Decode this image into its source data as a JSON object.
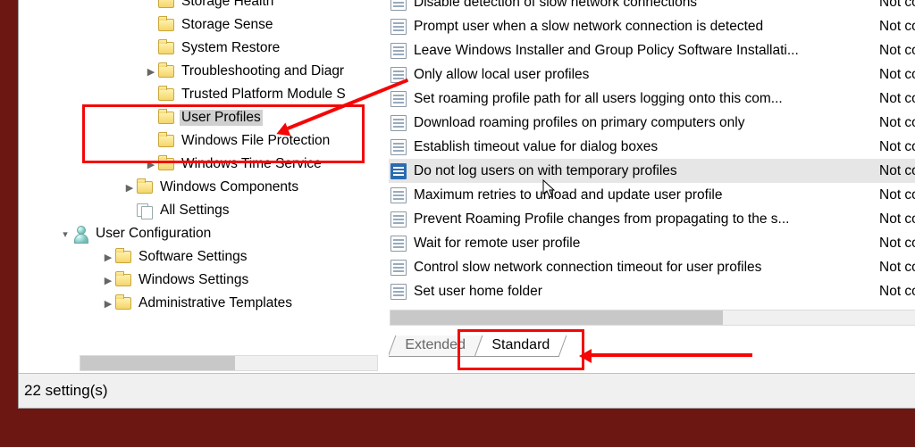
{
  "tree": [
    {
      "indent": 5,
      "exp": "",
      "icon": "folder",
      "label": "Storage Health"
    },
    {
      "indent": 5,
      "exp": "",
      "icon": "folder",
      "label": "Storage Sense"
    },
    {
      "indent": 5,
      "exp": "",
      "icon": "folder",
      "label": "System Restore"
    },
    {
      "indent": 5,
      "exp": ">",
      "icon": "folder",
      "label": "Troubleshooting and Diagr"
    },
    {
      "indent": 5,
      "exp": "",
      "icon": "folder",
      "label": "Trusted Platform Module S"
    },
    {
      "indent": 5,
      "exp": "",
      "icon": "folder",
      "label": "User Profiles",
      "selected": true
    },
    {
      "indent": 5,
      "exp": "",
      "icon": "folder",
      "label": "Windows File Protection"
    },
    {
      "indent": 5,
      "exp": ">",
      "icon": "folder",
      "label": "Windows Time Service"
    },
    {
      "indent": 4,
      "exp": ">",
      "icon": "folder",
      "label": "Windows Components"
    },
    {
      "indent": 4,
      "exp": "",
      "icon": "allset",
      "label": "All Settings"
    },
    {
      "indent": 1,
      "exp": "v",
      "icon": "userconf",
      "label": "User Configuration"
    },
    {
      "indent": 3,
      "exp": ">",
      "icon": "folder",
      "label": "Software Settings"
    },
    {
      "indent": 3,
      "exp": ">",
      "icon": "folder",
      "label": "Windows Settings"
    },
    {
      "indent": 3,
      "exp": ">",
      "icon": "folder",
      "label": "Administrative Templates"
    }
  ],
  "policies": [
    {
      "setting": "Disable detection of slow network connections",
      "state": "Not con"
    },
    {
      "setting": "Prompt user when a slow network connection is detected",
      "state": "Not con"
    },
    {
      "setting": "Leave Windows Installer and Group Policy Software Installati...",
      "state": "Not con"
    },
    {
      "setting": "Only allow local user profiles",
      "state": "Not con"
    },
    {
      "setting": "Set roaming profile path for all users logging onto this com...",
      "state": "Not con"
    },
    {
      "setting": "Download roaming profiles on primary computers only",
      "state": "Not con"
    },
    {
      "setting": "Establish timeout value for dialog boxes",
      "state": "Not con"
    },
    {
      "setting": "Do not log users on with temporary profiles",
      "state": "Not con",
      "selected": true,
      "solidIcon": true
    },
    {
      "setting": "Maximum retries to unload and update user profile",
      "state": "Not con"
    },
    {
      "setting": "Prevent Roaming Profile changes from propagating to the s...",
      "state": "Not con"
    },
    {
      "setting": "Wait for remote user profile",
      "state": "Not con"
    },
    {
      "setting": "Control slow network connection timeout for user profiles",
      "state": "Not con"
    },
    {
      "setting": "Set user home folder",
      "state": "Not con"
    }
  ],
  "tabs": {
    "extended": "Extended",
    "standard": "Standard",
    "active": "standard"
  },
  "status": "22 setting(s)"
}
